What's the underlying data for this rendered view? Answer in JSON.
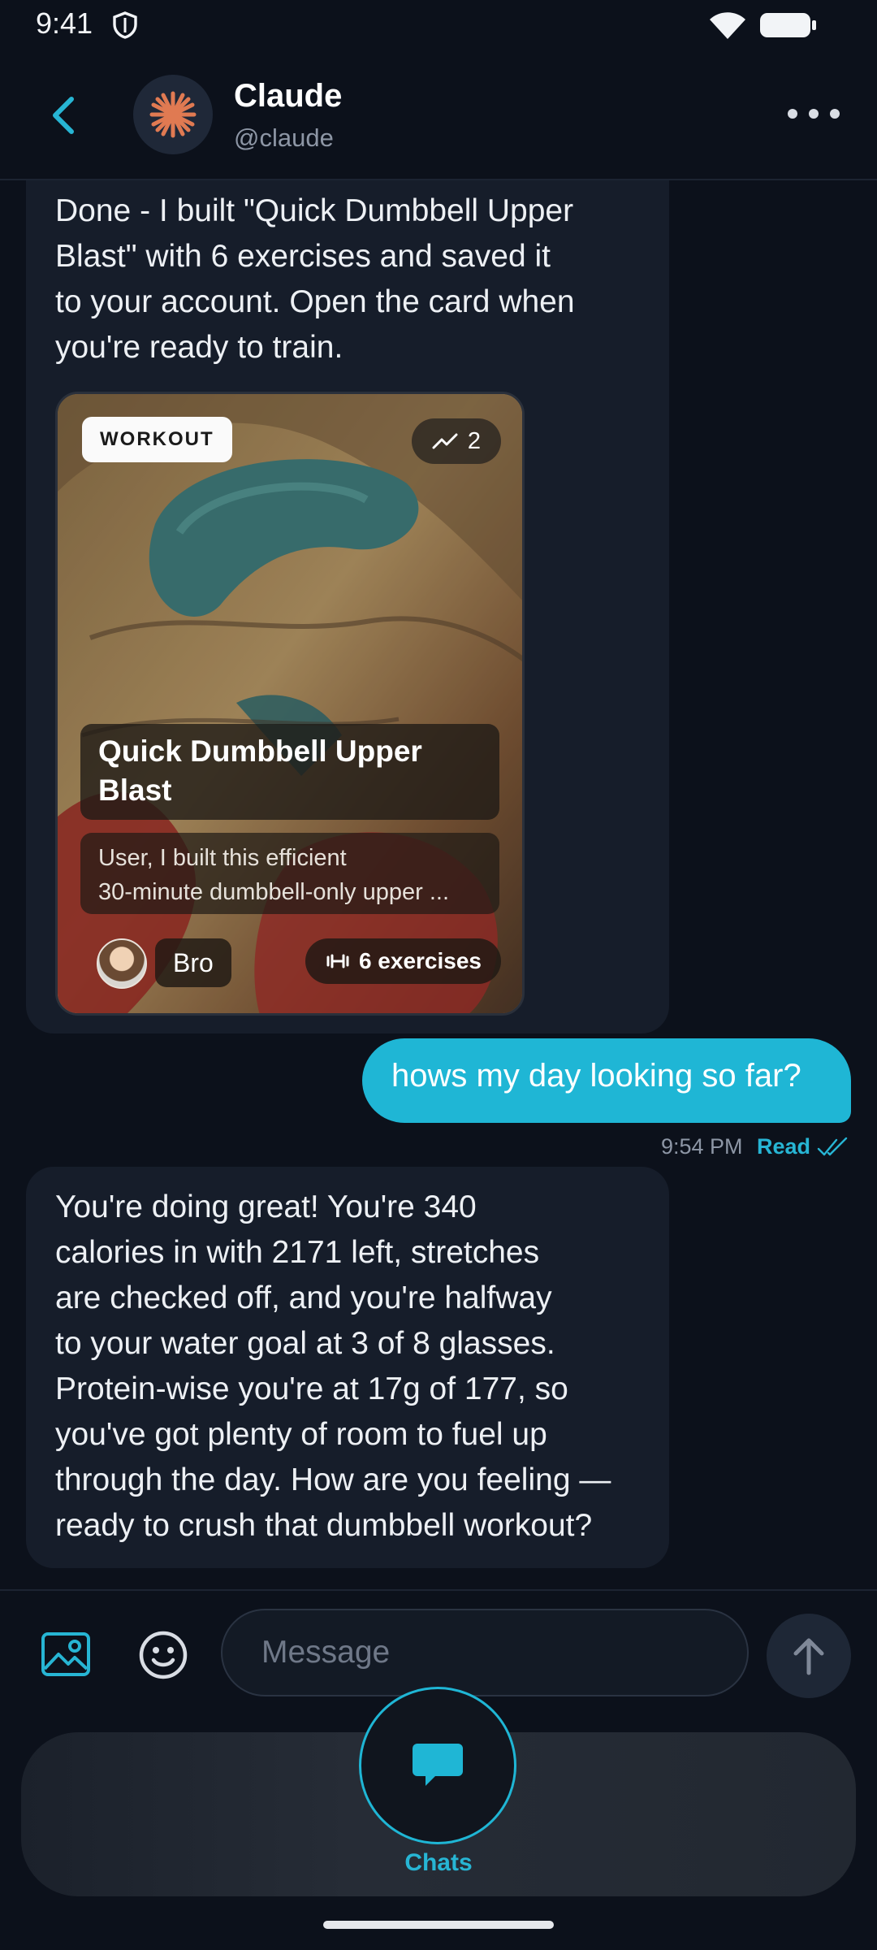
{
  "status_bar": {
    "time": "9:41"
  },
  "header": {
    "name": "Claude",
    "handle": "@claude"
  },
  "messages": {
    "m1": {
      "lines": [
        "Done - I built \"Quick Dumbbell Upper",
        "Blast\" with 6 exercises and saved it",
        "to your account. Open the card when",
        "you're ready to train."
      ]
    },
    "card": {
      "badge": "WORKOUT",
      "trend_count": "2",
      "title_line1": "Quick Dumbbell Upper",
      "title_line2": "Blast",
      "desc_line1": "User, I built this efficient",
      "desc_line2": "30-minute dumbbell-only upper ...",
      "author": "Bro",
      "exercises": "6 exercises"
    },
    "m2": {
      "text": "hows my day looking so far?",
      "time": "9:54 PM",
      "status": "Read"
    },
    "m3": {
      "lines": [
        "You're doing great! You're 340",
        "calories in with 2171 left, stretches",
        "are checked off, and you're halfway",
        "to your water goal at 3 of 8 glasses.",
        "Protein-wise you're at 17g of 177, so",
        "you've got plenty of room to fuel up",
        "through the day. How are you feeling —",
        "ready to crush that dumbbell workout?"
      ]
    }
  },
  "composer": {
    "placeholder": "Message"
  },
  "nav": {
    "chats_label": "Chats"
  },
  "colors": {
    "accent": "#1fb6d5",
    "background": "#0c111b",
    "bubble_in": "#161d2a"
  }
}
